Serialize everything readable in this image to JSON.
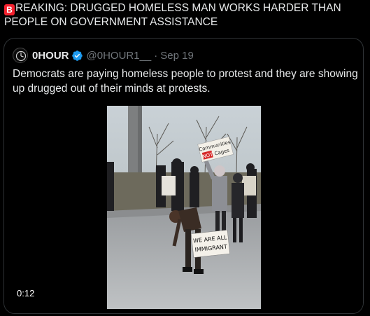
{
  "post": {
    "badge_letter": "B",
    "text": "REAKING: DRUGGED HOMELESS MAN WORKS HARDER THAN PEOPLE ON GOVERNMENT ASSISTANCE"
  },
  "quote": {
    "display_name": "0HOUR",
    "handle": "@0HOUR1__",
    "separator": "·",
    "date": "Sep 19",
    "text": "Democrats are paying homeless people to protest and they are showing up drugged out of their minds at protests.",
    "video": {
      "duration": "0:12",
      "signs": {
        "sign1_line1": "Communities",
        "sign1_line2": "NOT",
        "sign1_line3": "Cages",
        "sign2_line1": "WE ARE ALL",
        "sign2_line2": "IMMIGRANT"
      }
    }
  },
  "colors": {
    "background": "#000000",
    "text": "#e7e9ea",
    "muted": "#71767b",
    "border": "#2f3336",
    "verified": "#1d9bf0",
    "badge": "#f4212e"
  },
  "icons": [
    "b-letter-badge-icon",
    "verified-badge-icon",
    "avatar"
  ]
}
